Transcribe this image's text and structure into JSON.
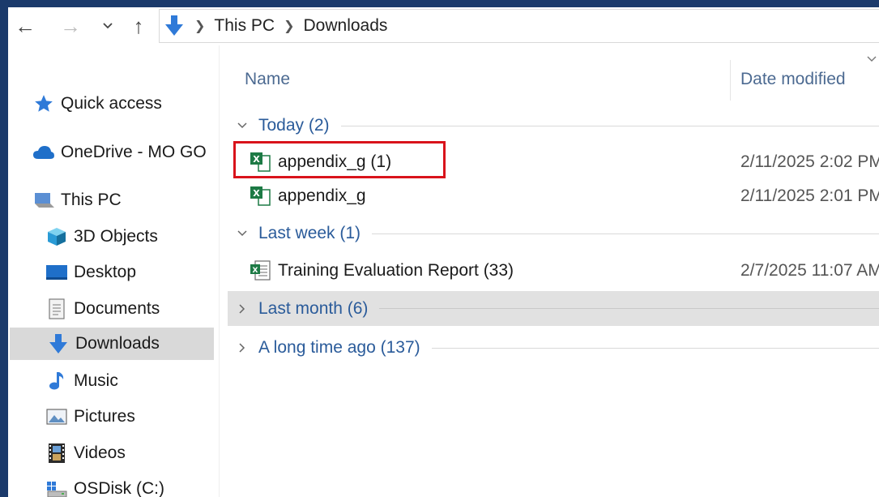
{
  "address": {
    "crumbs": [
      "This PC",
      "Downloads"
    ],
    "icons": {
      "back": "back-arrow-icon",
      "forward": "forward-arrow-icon",
      "recent": "chevron-down-icon",
      "up": "up-arrow-icon",
      "location": "downloads-icon"
    }
  },
  "nav": {
    "items": [
      {
        "label": "Quick access",
        "icon": "star-icon"
      },
      {
        "label": "OneDrive - MO GO",
        "icon": "cloud-icon"
      },
      {
        "label": "This PC",
        "icon": "computer-icon"
      },
      {
        "label": "3D Objects",
        "icon": "cube-icon"
      },
      {
        "label": "Desktop",
        "icon": "desktop-icon"
      },
      {
        "label": "Documents",
        "icon": "document-icon"
      },
      {
        "label": "Downloads",
        "icon": "downloads-icon",
        "selected": true
      },
      {
        "label": "Music",
        "icon": "music-note-icon"
      },
      {
        "label": "Pictures",
        "icon": "pictures-icon"
      },
      {
        "label": "Videos",
        "icon": "film-icon"
      },
      {
        "label": "OSDisk (C:)",
        "icon": "drive-icon"
      }
    ]
  },
  "columns": {
    "name": "Name",
    "date": "Date modified"
  },
  "groups": [
    {
      "label": "Today (2)",
      "expanded": true,
      "files": [
        {
          "name": "appendix_g (1)",
          "date": "2/11/2025 2:02 PM",
          "icon": "excel-file-icon",
          "highlighted": true
        },
        {
          "name": "appendix_g",
          "date": "2/11/2025 2:01 PM",
          "icon": "excel-file-icon"
        }
      ]
    },
    {
      "label": "Last week (1)",
      "expanded": true,
      "files": [
        {
          "name": "Training Evaluation Report (33)",
          "date": "2/7/2025 11:07 AM",
          "icon": "excel-csv-icon"
        }
      ]
    },
    {
      "label": "Last month (6)",
      "expanded": false,
      "hovered": true,
      "files": []
    },
    {
      "label": "A long time ago (137)",
      "expanded": false,
      "files": []
    }
  ],
  "colors": {
    "accent": "#2a5b9a",
    "highlight_box": "#d9131b",
    "selection": "#d9d9d9",
    "frame": "#1b3a6b"
  }
}
